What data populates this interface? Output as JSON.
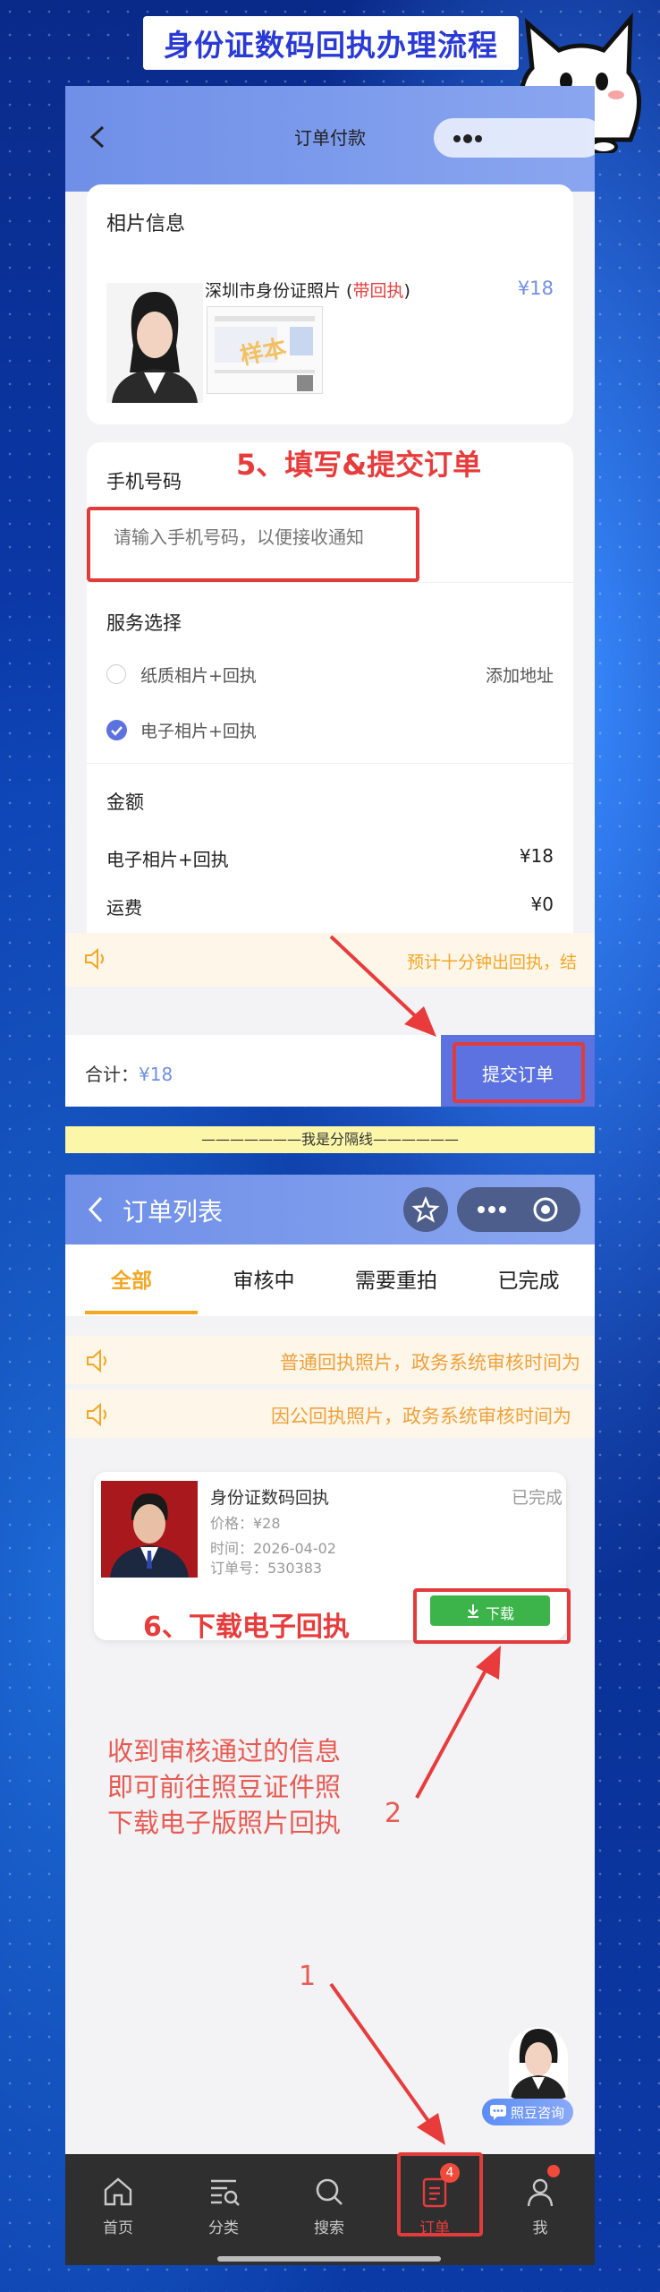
{
  "banner_title": "身份证数码回执办理流程",
  "order_pay": {
    "header_title": "订单付款",
    "photo_section_title": "相片信息",
    "product_name": "深圳市身份证照片 (",
    "product_badge": "带回执",
    "product_name_end": ")",
    "product_price": "¥18",
    "sample_mark": "样本",
    "phone_label": "手机号码",
    "phone_placeholder": "请输入手机号码，以便接收通知",
    "service_title": "服务选择",
    "service_options": [
      {
        "label": "纸质相片+回执",
        "selected": false,
        "extra": "添加地址"
      },
      {
        "label": "电子相片+回执",
        "selected": true,
        "extra": ""
      }
    ],
    "amount_title": "金额",
    "amount_rows": [
      {
        "label": "电子相片+回执",
        "value": "¥18"
      },
      {
        "label": "运费",
        "value": "¥0"
      }
    ],
    "notice": "预计十分钟出回执，结",
    "total_label": "合计：",
    "total_value": "¥18",
    "submit_label": "提交订单"
  },
  "step5_label": "5、填写&提交订单",
  "divider_text": "———————我是分隔线——————",
  "order_list": {
    "header_title": "订单列表",
    "tabs": [
      "全部",
      "审核中",
      "需要重拍",
      "已完成"
    ],
    "active_tab": 0,
    "notices": [
      "普通回执照片，政务系统审核时间为",
      "因公回执照片，政务系统审核时间为"
    ],
    "order": {
      "title": "身份证数码回执",
      "status": "已完成",
      "price": "价格：¥28",
      "time": "时间：2026-04-02",
      "order_no": "订单号：530383",
      "download_label": "下载"
    },
    "consult_label": "照豆咨询",
    "nav": [
      {
        "label": "首页",
        "icon": "home-icon"
      },
      {
        "label": "分类",
        "icon": "category-icon"
      },
      {
        "label": "搜索",
        "icon": "search-icon"
      },
      {
        "label": "订单",
        "icon": "order-icon",
        "badge": "4",
        "active": true
      },
      {
        "label": "我",
        "icon": "user-icon"
      }
    ]
  },
  "step6_label": "6、下载电子回执",
  "annotation_text": [
    "收到审核通过的信息",
    "即可前往照豆证件照",
    "下载电子版照片回执"
  ],
  "arrow_number_2": "2",
  "arrow_number_1": "1",
  "colors": {
    "accent_blue": "#6f8fe8",
    "red": "#e83c3c",
    "green": "#3cb44a",
    "orange": "#f5a623"
  }
}
